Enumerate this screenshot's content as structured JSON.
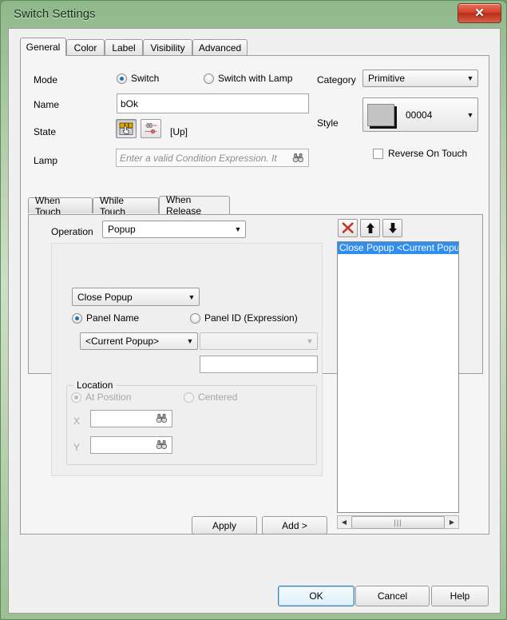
{
  "window": {
    "title": "Switch Settings",
    "close_label": "✕"
  },
  "tabs": [
    {
      "label": "General",
      "active": true
    },
    {
      "label": "Color",
      "active": false
    },
    {
      "label": "Label",
      "active": false
    },
    {
      "label": "Visibility",
      "active": false
    },
    {
      "label": "Advanced",
      "active": false
    }
  ],
  "general": {
    "mode_label": "Mode",
    "mode_switch": "Switch",
    "mode_switch_with_lamp": "Switch with Lamp",
    "name_label": "Name",
    "name_value": "bOk",
    "state_label": "State",
    "state_value": "[Up]",
    "lamp_label": "Lamp",
    "lamp_placeholder": "Enter a valid Condition Expression. It",
    "category_label": "Category",
    "category_value": "Primitive",
    "style_label": "Style",
    "style_value": "00004",
    "reverse_on_touch": "Reverse On Touch"
  },
  "action_tabs": [
    {
      "label": "When Touch",
      "active": false
    },
    {
      "label": "While Touch",
      "active": false
    },
    {
      "label": "When Release",
      "active": true
    }
  ],
  "action": {
    "operation_label": "Operation",
    "operation_value": "Popup",
    "popup_action_value": "Close Popup",
    "panel_name_label": "Panel Name",
    "panel_name_value": "<Current Popup>",
    "panel_id_label": "Panel ID (Expression)",
    "panel_id_value": "",
    "panel_id_text_value": "",
    "location_label": "Location",
    "at_position_label": "At Position",
    "centered_label": "Centered",
    "x_label": "X",
    "x_value": "",
    "y_label": "Y",
    "y_value": "",
    "apply_label": "Apply",
    "add_label": "Add >"
  },
  "action_list": {
    "delete_icon": "delete-icon",
    "move_up_icon": "move-up-icon",
    "move_down_icon": "move-down-icon",
    "items": [
      "Close Popup <Current Popup>"
    ],
    "scroll_left": "◀",
    "scroll_right": "▶",
    "scroll_grip": "|||"
  },
  "footer": {
    "ok_label": "OK",
    "cancel_label": "Cancel",
    "help_label": "Help"
  },
  "colors": {
    "selection": "#2f8ef0",
    "titlebar": "#b2cdaa",
    "close_red": "#d2452c",
    "focus_blue": "#3c7fb1"
  }
}
